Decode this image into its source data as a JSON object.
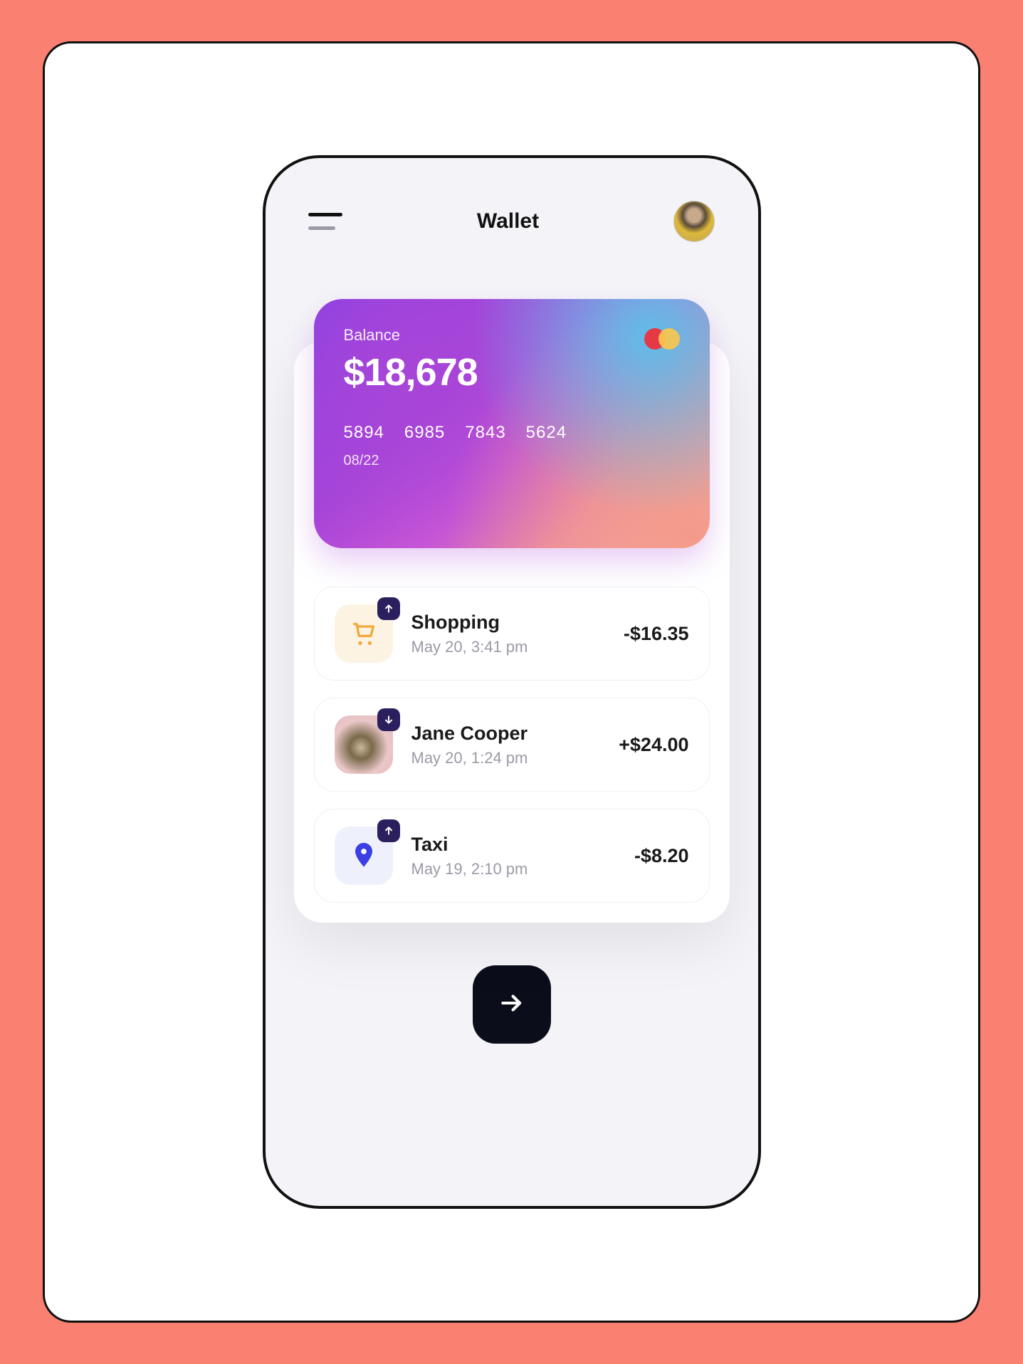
{
  "header": {
    "title": "Wallet"
  },
  "card": {
    "label": "Balance",
    "balance": "$18,678",
    "number_groups": [
      "5894",
      "6985",
      "7843",
      "5624"
    ],
    "expiry": "08/22"
  },
  "transactions": [
    {
      "icon": "cart",
      "direction": "out",
      "title": "Shopping",
      "date": "May 20, 3:41 pm",
      "amount": "-$16.35"
    },
    {
      "icon": "person",
      "direction": "in",
      "title": "Jane Cooper",
      "date": "May 20, 1:24 pm",
      "amount": "+$24.00"
    },
    {
      "icon": "pin",
      "direction": "out",
      "title": "Taxi",
      "date": "May 19, 2:10 pm",
      "amount": "-$8.20"
    }
  ]
}
